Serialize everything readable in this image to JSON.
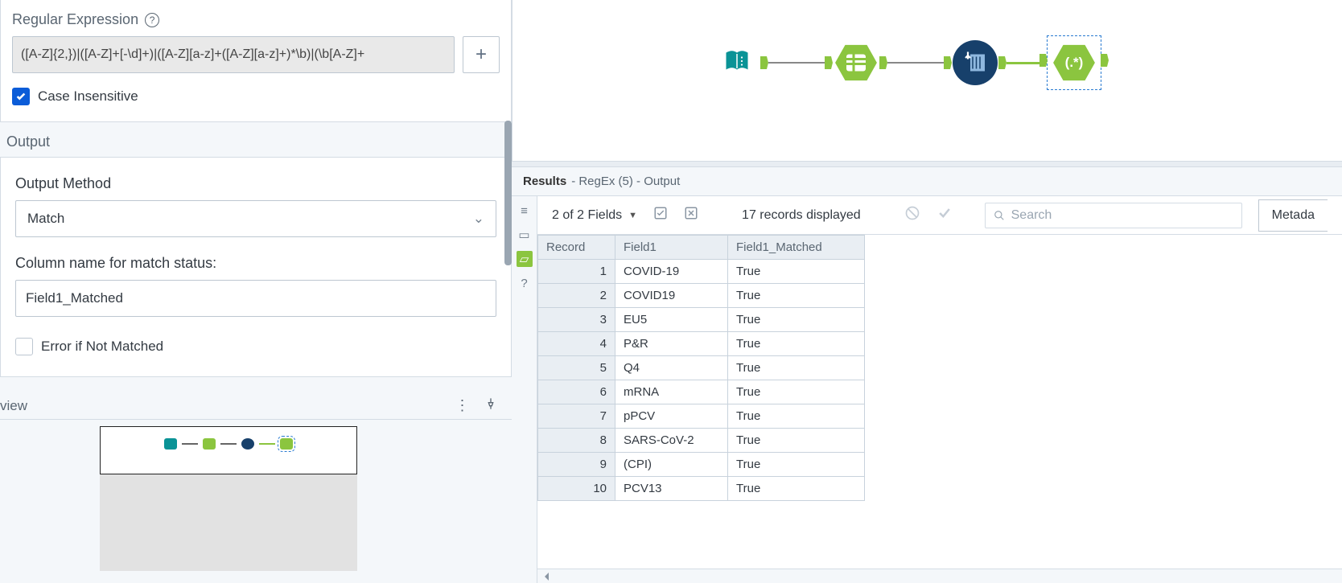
{
  "config": {
    "regex_label": "Regular Expression",
    "regex_value": "([A-Z]{2,})|([A-Z]+[-\\d]+)|([A-Z][a-z]+([A-Z][a-z]+)*\\b)|(\\b[A-Z]+",
    "add_button": "+",
    "case_insensitive_label": "Case Insensitive",
    "case_insensitive_checked": true,
    "output_section": "Output",
    "output_method_label": "Output Method",
    "output_method_value": "Match",
    "colname_label": "Column name for match status:",
    "colname_value": "Field1_Matched",
    "error_if_not_matched_label": "Error if Not Matched",
    "error_if_not_matched_checked": false
  },
  "overview": {
    "label": "view",
    "kebab": "⋮",
    "pin": "📌"
  },
  "canvas": {
    "tools": [
      "input-book",
      "text-input-tool",
      "data-cleanse",
      "regex"
    ]
  },
  "results": {
    "title": "Results",
    "path": " - RegEx (5) - Output",
    "fields_summary": "2 of 2 Fields",
    "records_summary": "17 records displayed",
    "search_placeholder": "Search",
    "metadata_button": "Metada",
    "columns": [
      "Record",
      "Field1",
      "Field1_Matched"
    ],
    "rows": [
      {
        "n": 1,
        "f": "COVID-19",
        "m": "True"
      },
      {
        "n": 2,
        "f": "COVID19",
        "m": "True"
      },
      {
        "n": 3,
        "f": "EU5",
        "m": "True"
      },
      {
        "n": 4,
        "f": "P&R",
        "m": "True"
      },
      {
        "n": 5,
        "f": "Q4",
        "m": "True"
      },
      {
        "n": 6,
        "f": "mRNA",
        "m": "True"
      },
      {
        "n": 7,
        "f": "pPCV",
        "m": "True"
      },
      {
        "n": 8,
        "f": "SARS-CoV-2",
        "m": "True"
      },
      {
        "n": 9,
        "f": "(CPI)",
        "m": "True"
      },
      {
        "n": 10,
        "f": "PCV13",
        "m": "True"
      }
    ]
  }
}
